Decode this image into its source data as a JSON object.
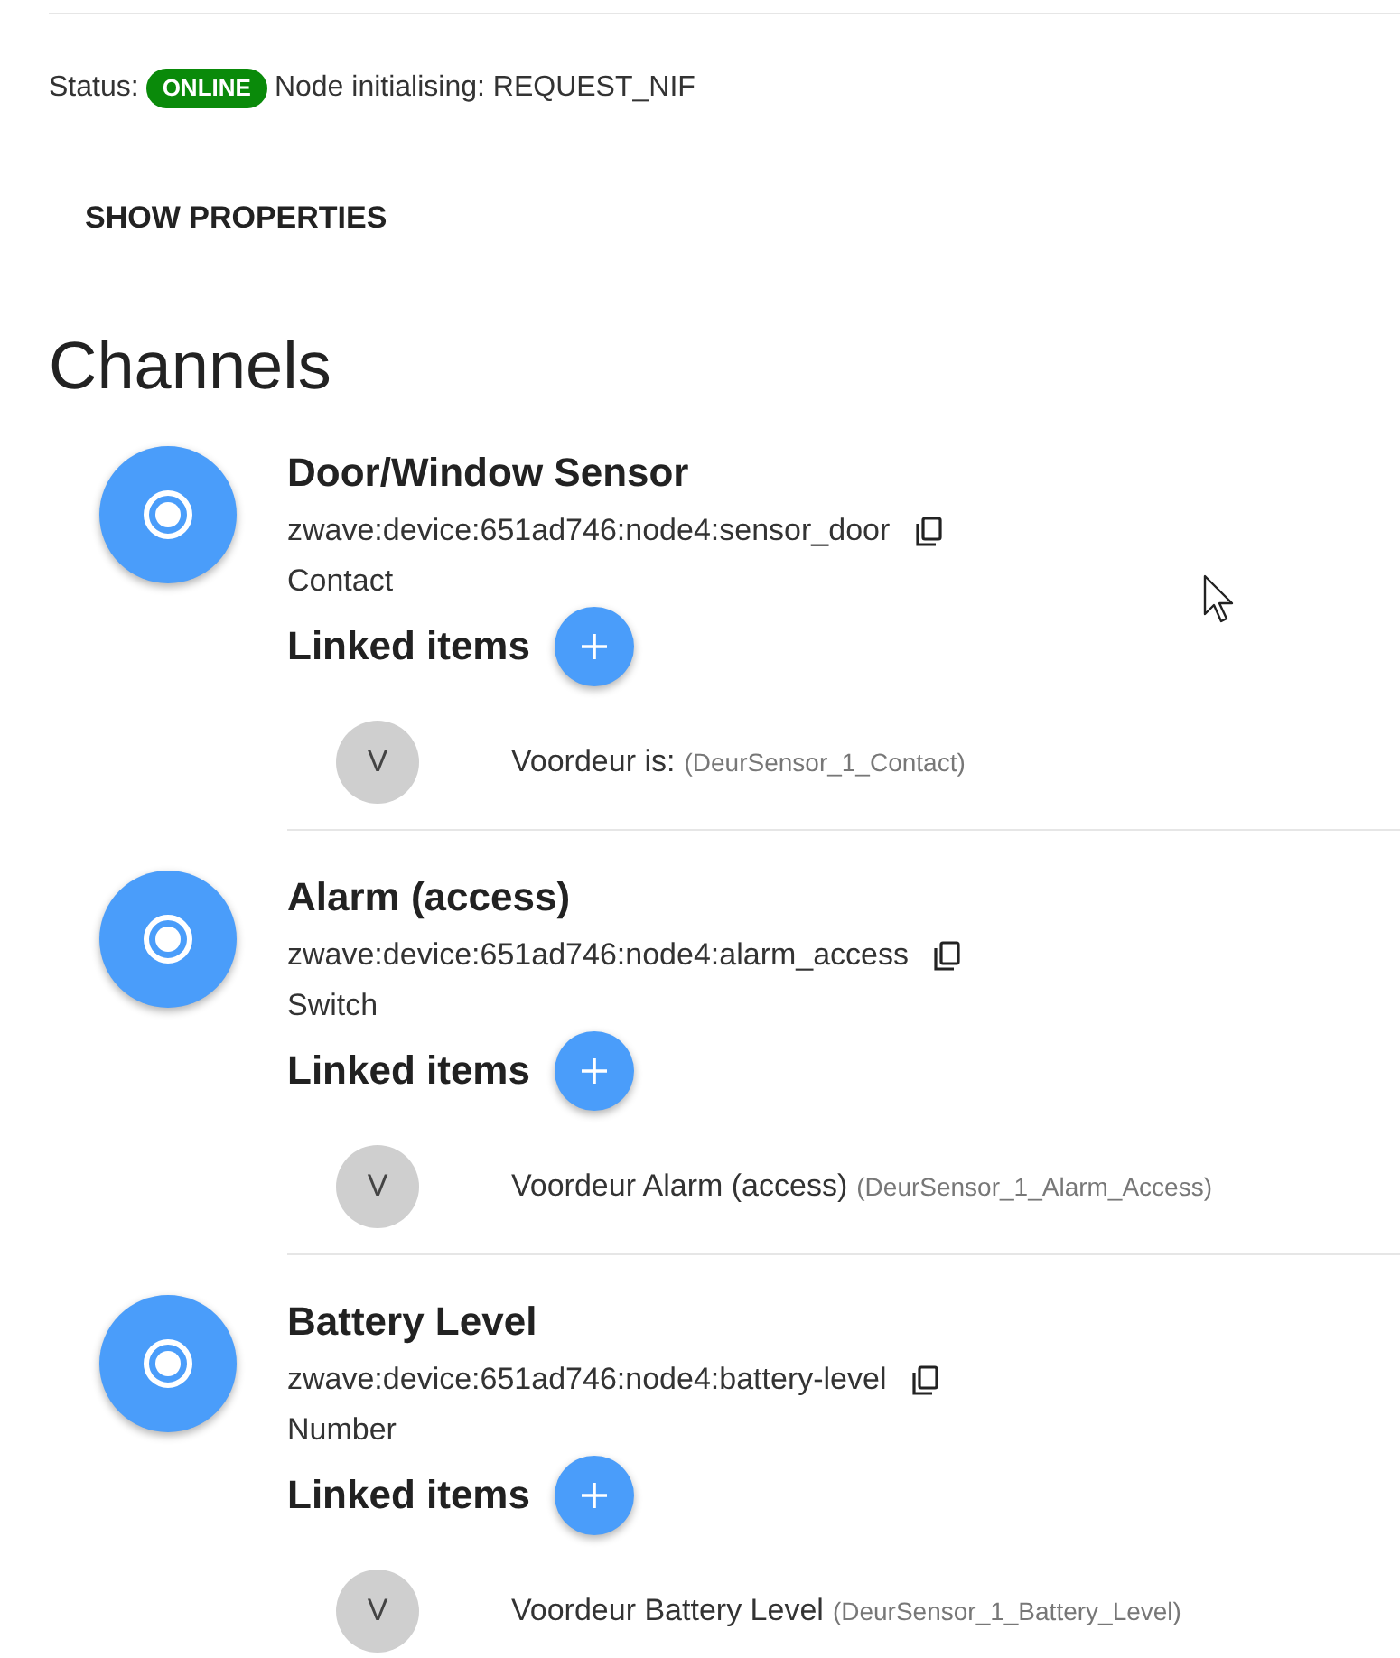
{
  "status": {
    "label": "Status:",
    "badge": "ONLINE",
    "detail": "Node initialising: REQUEST_NIF"
  },
  "show_properties_button": "SHOW PROPERTIES",
  "heading": "Channels",
  "channels": [
    {
      "title": "Door/Window Sensor",
      "uid": "zwave:device:651ad746:node4:sensor_door",
      "type": "Contact",
      "linked_heading": "Linked items",
      "items": [
        {
          "avatar": "V",
          "name": "Voordeur is:",
          "label": "(DeurSensor_1_Contact)"
        }
      ]
    },
    {
      "title": "Alarm (access)",
      "uid": "zwave:device:651ad746:node4:alarm_access",
      "type": "Switch",
      "linked_heading": "Linked items",
      "items": [
        {
          "avatar": "V",
          "name": "Voordeur Alarm (access)",
          "label": "(DeurSensor_1_Alarm_Access)"
        }
      ]
    },
    {
      "title": "Battery Level",
      "uid": "zwave:device:651ad746:node4:battery-level",
      "type": "Number",
      "linked_heading": "Linked items",
      "items": [
        {
          "avatar": "V",
          "name": "Voordeur Battery Level",
          "label": "(DeurSensor_1_Battery_Level)"
        }
      ]
    }
  ]
}
